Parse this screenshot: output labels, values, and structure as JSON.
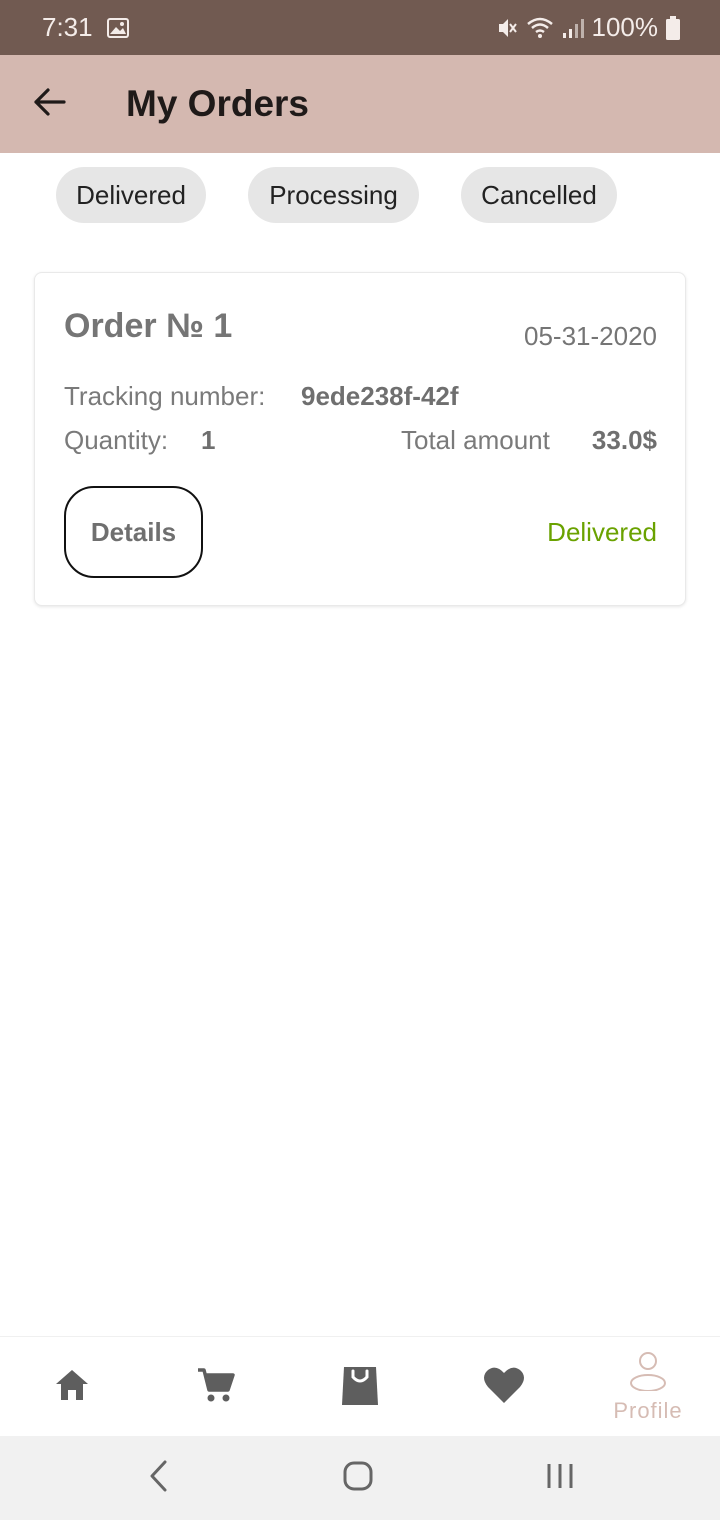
{
  "status_bar": {
    "time": "7:31",
    "battery": "100%",
    "icons": [
      "image-icon",
      "mute-icon",
      "wifi-icon",
      "signal-icon",
      "battery-icon"
    ]
  },
  "header": {
    "title": "My Orders",
    "back_icon": "arrow-left-icon"
  },
  "filters": [
    {
      "label": "Delivered"
    },
    {
      "label": "Processing"
    },
    {
      "label": "Cancelled"
    }
  ],
  "orders": [
    {
      "title": "Order № 1",
      "date": "05-31-2020",
      "tracking_label": "Tracking number:",
      "tracking_number": "9ede238f-42f",
      "quantity_label": "Quantity:",
      "quantity": "1",
      "amount_label": "Total amount",
      "amount": "33.0$",
      "details_label": "Details",
      "status": "Delivered"
    }
  ],
  "bottom_nav": {
    "items": [
      {
        "icon": "home-icon"
      },
      {
        "icon": "cart-icon"
      },
      {
        "icon": "shopping-bag-icon"
      },
      {
        "icon": "heart-icon"
      },
      {
        "icon": "profile-icon",
        "label": "Profile",
        "active": true
      }
    ]
  },
  "system_nav": [
    "back-icon",
    "home-circle-icon",
    "recent-apps-icon"
  ],
  "colors": {
    "status_bar": "#715a51",
    "app_bar": "#d4b8b0",
    "delivered_status": "#6aa200",
    "active_nav": "#d6bcb4",
    "chip_bg": "#e6e6e6"
  }
}
